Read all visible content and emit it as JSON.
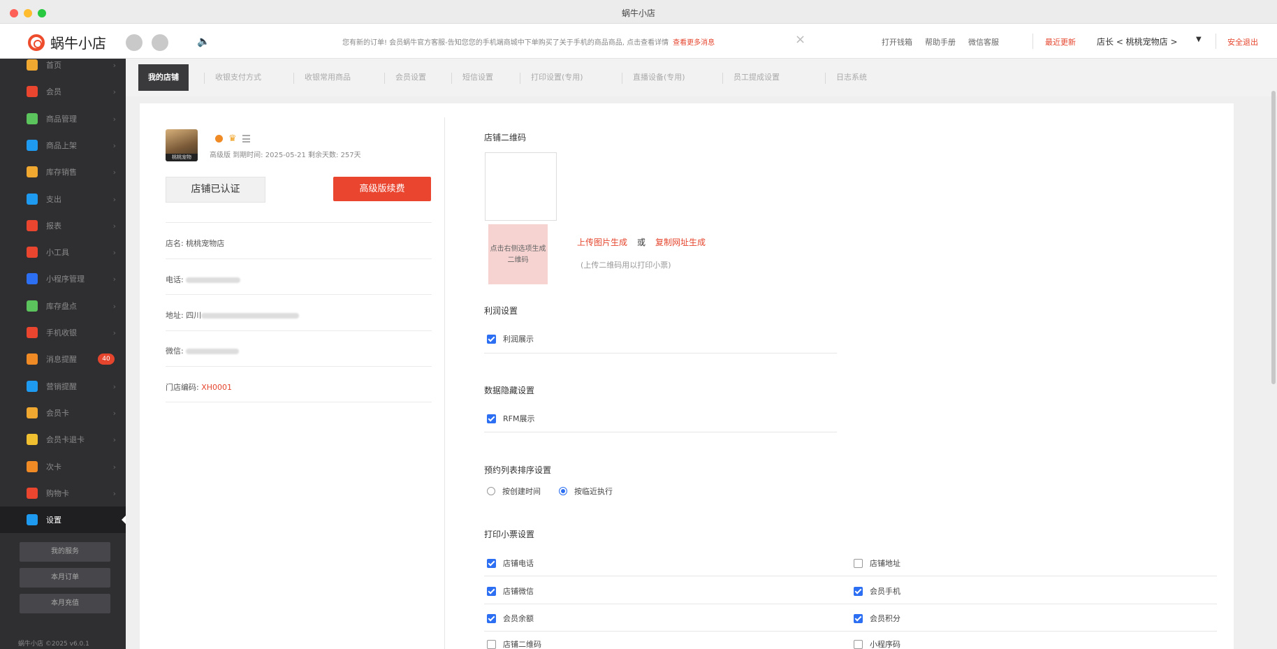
{
  "window": {
    "title": "蜗牛小店"
  },
  "header": {
    "app_name": "蜗牛小店",
    "notice": "您有新的订单! 会员蜗牛官方客服-告知您您的手机端商城中下单购买了关于手机的商品商品, 点击查看详情",
    "notice_more": "查看更多消息",
    "links": [
      "打开钱箱",
      "帮助手册",
      "微信客服"
    ],
    "recent_update": "最近更新",
    "owner": "店长 < 桃桃宠物店 >",
    "logout": "安全退出"
  },
  "sidebar": {
    "items": [
      {
        "label": "首页",
        "color": "#f0a830"
      },
      {
        "label": "会员",
        "color": "#e9452f"
      },
      {
        "label": "商品管理",
        "color": "#5cc45c"
      },
      {
        "label": "商品上架",
        "color": "#1e9af0"
      },
      {
        "label": "库存销售",
        "color": "#f0a830"
      },
      {
        "label": "支出",
        "color": "#1e9af0"
      },
      {
        "label": "报表",
        "color": "#e9452f"
      },
      {
        "label": "小工具",
        "color": "#e9452f"
      },
      {
        "label": "小程序管理",
        "color": "#2d6ff2"
      },
      {
        "label": "库存盘点",
        "color": "#5cc45c"
      },
      {
        "label": "手机收银",
        "color": "#e9452f"
      },
      {
        "label": "消息提醒",
        "color": "#f08a24",
        "badge": "40"
      },
      {
        "label": "营销提醒",
        "color": "#1e9af0"
      },
      {
        "label": "会员卡",
        "color": "#f0a830"
      },
      {
        "label": "会员卡退卡",
        "color": "#f0c030"
      },
      {
        "label": "次卡",
        "color": "#f08a24"
      },
      {
        "label": "购物卡",
        "color": "#e9452f"
      },
      {
        "label": "设置",
        "color": "#1e9af0",
        "active": true
      }
    ],
    "buttons": [
      "我的服务",
      "本月订单",
      "本月充值"
    ],
    "footer": "蜗牛小店 ©2025 v6.0.1"
  },
  "tabs": [
    "我的店铺",
    "收银支付方式",
    "收银常用商品",
    "会员设置",
    "短信设置",
    "打印设置(专用)",
    "直播设备(专用)",
    "员工提成设置",
    "日志系统"
  ],
  "shop": {
    "meta": "高级版 到期时间: 2025-05-21 剩余天数: 257天",
    "verified_label": "店铺已认证",
    "renew_label": "高级版续费",
    "name_label": "店名:",
    "name": "桃桃宠物店",
    "phone_label": "电话:",
    "address_label": "地址:",
    "address_prefix": "四川",
    "wechat_label": "微信:",
    "code_label": "门店编码:",
    "code": "XH0001",
    "avatar_tag": "桃桃宠物"
  },
  "settings": {
    "qr_title": "店铺二维码",
    "qr_button": "点击右侧选项生成二维码",
    "upload_link": "上传图片生成",
    "or": "或",
    "copy_link": "复制网址生成",
    "qr_tip": "(上传二维码用以打印小票)",
    "profit_title": "利润设置",
    "profit_show": "利润展示",
    "hide_title": "数据隐藏设置",
    "rfm_show": "RFM展示",
    "sort_title": "预约列表排序设置",
    "sort_created": "按创建时间",
    "sort_recent": "按临近执行",
    "print_title": "打印小票设置",
    "print_options": {
      "shop_phone": "店铺电话",
      "shop_address": "店铺地址",
      "shop_wechat": "店铺微信",
      "member_phone": "会员手机",
      "member_balance": "会员余额",
      "member_points": "会员积分",
      "shop_qr": "店铺二维码",
      "mini_program_code": "小程序码"
    }
  }
}
